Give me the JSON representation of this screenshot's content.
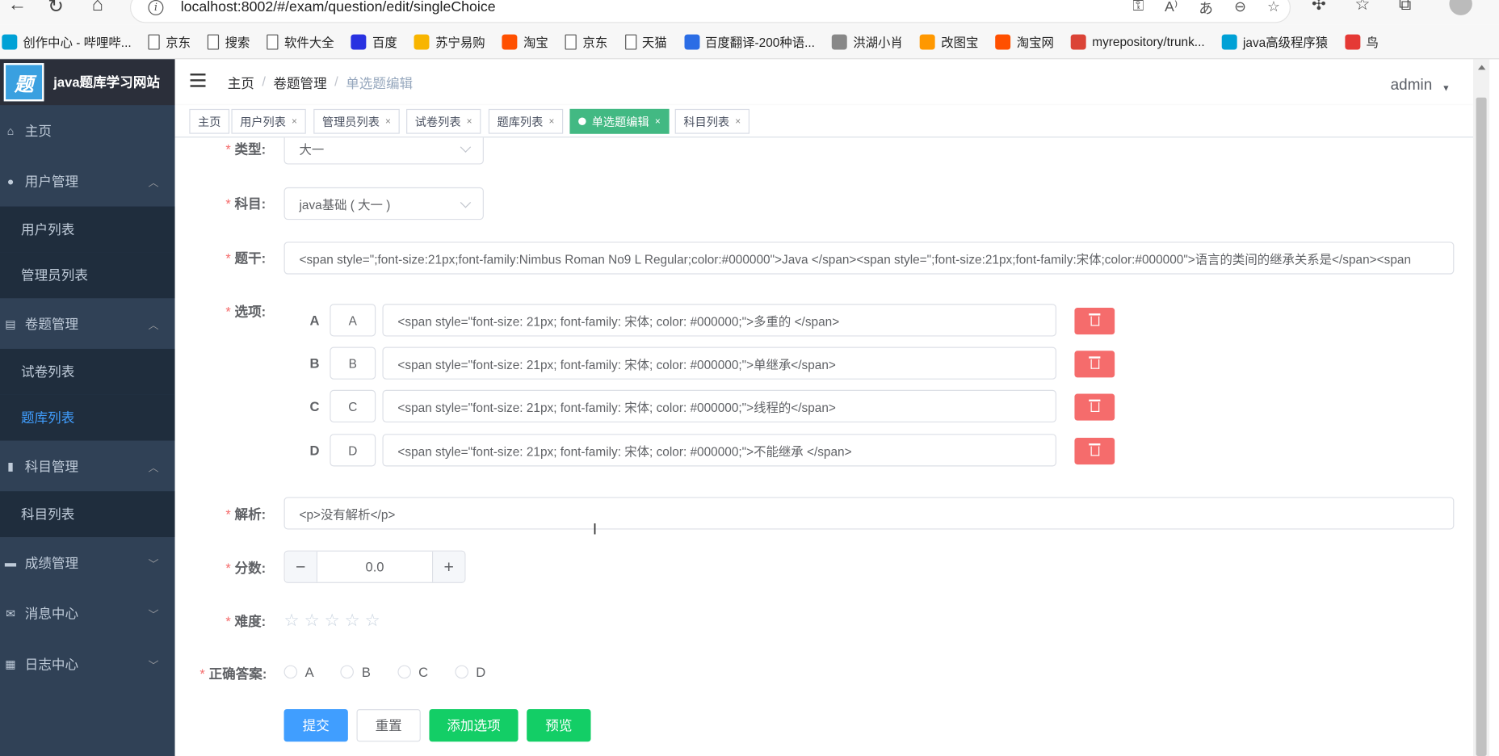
{
  "browser": {
    "url": "localhost:8002/#/exam/question/edit/singleChoice",
    "info_icon": "i",
    "bookmarks": [
      {
        "label": "创作中心 - 哔哩哔...",
        "icon": "bilibili-icon",
        "color": "#00a1d6"
      },
      {
        "label": "京东",
        "icon": "file-icon"
      },
      {
        "label": "搜索",
        "icon": "file-icon"
      },
      {
        "label": "软件大全",
        "icon": "file-icon"
      },
      {
        "label": "百度",
        "icon": "baidu-icon",
        "color": "#2932e1"
      },
      {
        "label": "苏宁易购",
        "icon": "suning-icon",
        "color": "#f8b500"
      },
      {
        "label": "淘宝",
        "icon": "taobao-icon",
        "color": "#ff5000"
      },
      {
        "label": "京东",
        "icon": "file-icon"
      },
      {
        "label": "天猫",
        "icon": "file-icon"
      },
      {
        "label": "百度翻译-200种语...",
        "icon": "baidu-translate-icon",
        "color": "#2b6de5"
      },
      {
        "label": "洪湖小肖",
        "icon": "pen-icon",
        "color": "#888888"
      },
      {
        "label": "改图宝",
        "icon": "gaitubao-icon",
        "color": "#ff9800"
      },
      {
        "label": "淘宝网",
        "icon": "taobao-icon",
        "color": "#ff5000"
      },
      {
        "label": "myrepository/trunk...",
        "icon": "chrome-icon",
        "color": "#db4437"
      },
      {
        "label": "java高级程序猿",
        "icon": "bilibili-icon",
        "color": "#00a1d6"
      },
      {
        "label": "鸟",
        "icon": "bird-icon",
        "color": "#e53935"
      }
    ]
  },
  "app": {
    "logo_text": "题",
    "title": "java题库学习网站"
  },
  "sidebar": {
    "items": [
      {
        "label": "主页",
        "icon": "home-icon"
      },
      {
        "label": "用户管理",
        "icon": "user-icon",
        "children": [
          "用户列表",
          "管理员列表"
        ]
      },
      {
        "label": "卷题管理",
        "icon": "paper-icon",
        "children": [
          "试卷列表",
          "题库列表"
        ]
      },
      {
        "label": "科目管理",
        "icon": "book-icon",
        "children": [
          "科目列表"
        ]
      },
      {
        "label": "成绩管理",
        "icon": "chat-icon"
      },
      {
        "label": "消息中心",
        "icon": "mail-icon"
      },
      {
        "label": "日志中心",
        "icon": "log-icon"
      }
    ],
    "active": "题库列表"
  },
  "header": {
    "breadcrumb": [
      "主页",
      "卷题管理",
      "单选题编辑"
    ],
    "user": "admin"
  },
  "tags": [
    {
      "label": "主页",
      "closable": false
    },
    {
      "label": "用户列表",
      "closable": true
    },
    {
      "label": "管理员列表",
      "closable": true
    },
    {
      "label": "试卷列表",
      "closable": true
    },
    {
      "label": "题库列表",
      "closable": true
    },
    {
      "label": "单选题编辑",
      "closable": true,
      "active": true
    },
    {
      "label": "科目列表",
      "closable": true
    }
  ],
  "form": {
    "type_label": "类型:",
    "type_value": "大一",
    "subject_label": "科目:",
    "subject_value": "java基础 ( 大一 )",
    "stem_label": "题干:",
    "stem_value": "<span style=\";font-size:21px;font-family:Nimbus Roman No9 L Regular;color:#000000\">Java </span><span style=\";font-size:21px;font-family:宋体;color:#000000\">语言的类间的继承关系是</span><span",
    "options_label": "选项:",
    "options": [
      {
        "letter": "A",
        "prefix": "A",
        "content": "<span style=\"font-size: 21px; font-family: 宋体; color: #000000;\">多重的 </span>"
      },
      {
        "letter": "B",
        "prefix": "B",
        "content": "<span style=\"font-size: 21px; font-family: 宋体; color: #000000;\">单继承</span>"
      },
      {
        "letter": "C",
        "prefix": "C",
        "content": "<span style=\"font-size: 21px; font-family: 宋体; color: #000000;\">线程的</span>"
      },
      {
        "letter": "D",
        "prefix": "D",
        "content": "<span style=\"font-size: 21px; font-family: 宋体; color: #000000;\">不能继承 </span>"
      }
    ],
    "analysis_label": "解析:",
    "analysis_value": "<p>没有解析</p>",
    "score_label": "分数:",
    "score_value": "0.0",
    "difficulty_label": "难度:",
    "difficulty_rating": 0,
    "difficulty_max": 5,
    "answer_label": "正确答案:",
    "answer_options": [
      "A",
      "B",
      "C",
      "D"
    ],
    "answer_selected": null
  },
  "buttons": {
    "submit": "提交",
    "reset": "重置",
    "add_option": "添加选项",
    "preview": "预览"
  },
  "colors": {
    "sidebar_bg": "#304156",
    "sidebar_active": "#409eff",
    "tag_active": "#42b983",
    "danger": "#f56c6c",
    "primary": "#409eff",
    "success": "#13ce66",
    "required": "#f56c6c"
  }
}
